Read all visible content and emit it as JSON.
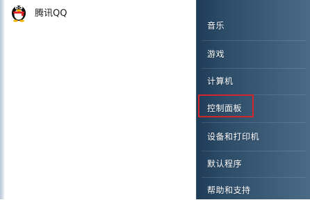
{
  "program_list": {
    "items": [
      {
        "label": "腾讯QQ",
        "icon": "qq-penguin-icon"
      }
    ]
  },
  "right_menu": {
    "items": [
      {
        "label": "音乐"
      },
      {
        "label": "游戏"
      },
      {
        "label": "计算机"
      },
      {
        "label": "控制面板"
      },
      {
        "label": "设备和打印机"
      },
      {
        "label": "默认程序"
      },
      {
        "label": "帮助和支持"
      }
    ]
  },
  "highlight": {
    "color": "#d3262a",
    "target": "控制面板"
  },
  "colors": {
    "panel_dark": "#1f3c57",
    "panel_light": "#4b6a86",
    "menu_text": "#ffffff"
  }
}
